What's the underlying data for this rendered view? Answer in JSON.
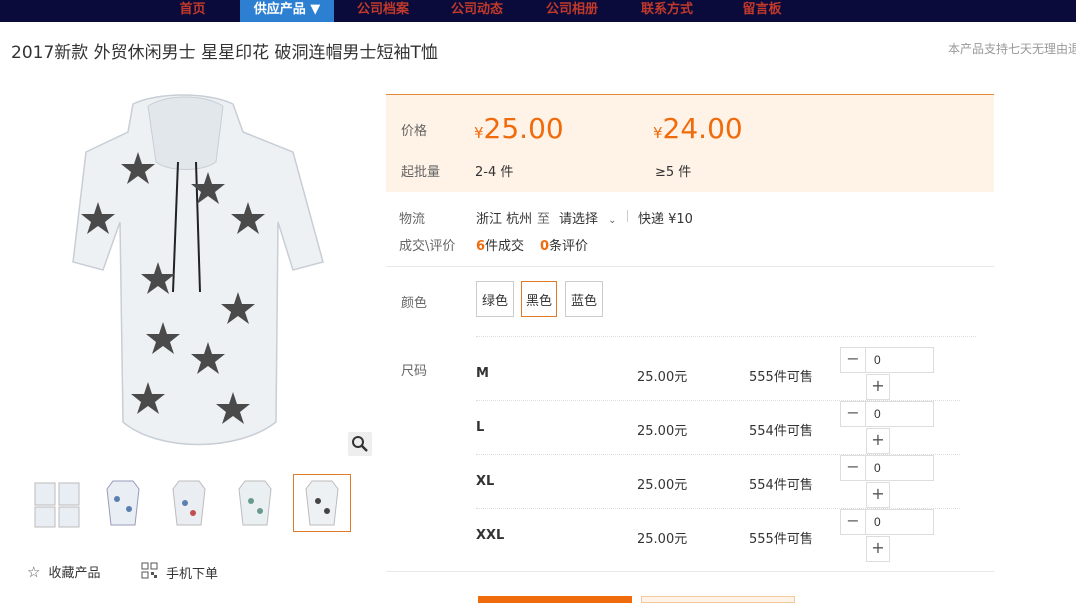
{
  "nav": {
    "items": [
      "首页",
      "供应产品 ▼",
      "公司档案",
      "公司动态",
      "公司相册",
      "联系方式",
      "留言板"
    ],
    "active_index": 1
  },
  "product": {
    "title": "2017新款 外贸休闲男士 星星印花 破洞连帽男士短袖T恤",
    "notice": "本产品支持七天无理由退"
  },
  "price": {
    "label": "价格",
    "tiers": [
      {
        "currency": "¥",
        "amount": "25.00",
        "qty": "2-4 件"
      },
      {
        "currency": "¥",
        "amount": "24.00",
        "qty": "≥5 件"
      }
    ],
    "moq_label": "起批量"
  },
  "logistics": {
    "label": "物流",
    "from": "浙江 杭州",
    "to_word": "至",
    "select": "请选择",
    "express": "快递 ¥10"
  },
  "deals": {
    "label": "成交\\评价",
    "sold_num": "6",
    "sold_text": "件成交",
    "review_num": "0",
    "review_text": "条评价"
  },
  "colors": {
    "label": "颜色",
    "options": [
      "绿色",
      "黑色",
      "蓝色"
    ],
    "selected_index": 1
  },
  "sizes": {
    "label": "尺码",
    "rows": [
      {
        "name": "M",
        "price": "25.00元",
        "stock": "555件可售",
        "qty": "0"
      },
      {
        "name": "L",
        "price": "25.00元",
        "stock": "554件可售",
        "qty": "0"
      },
      {
        "name": "XL",
        "price": "25.00元",
        "stock": "554件可售",
        "qty": "0"
      },
      {
        "name": "XXL",
        "price": "25.00元",
        "stock": "555件可售",
        "qty": "0"
      }
    ]
  },
  "actions": {
    "favorite": "收藏产品",
    "mobile_order": "手机下单"
  },
  "gallery": {
    "thumb_count": 5,
    "selected_index": 4
  },
  "colors_theme": {
    "accent": "#f06b0c",
    "nav_bg": "#0b0b3b",
    "nav_active": "#2d7fd1",
    "price_bg": "#fff2e6"
  }
}
